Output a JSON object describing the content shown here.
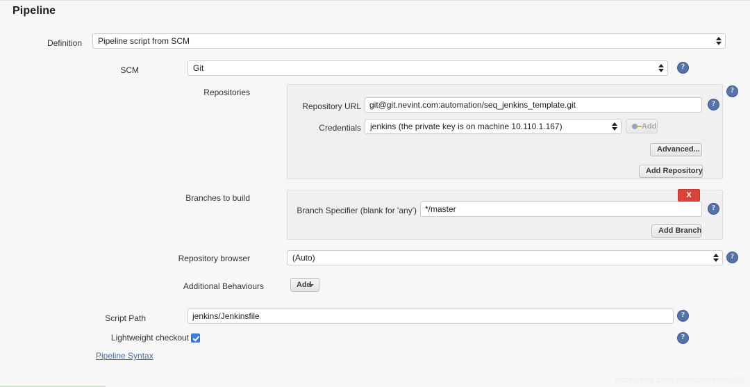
{
  "page": {
    "title": "Pipeline",
    "watermark": "https://blog.csdn.net/liuchunming033"
  },
  "definition": {
    "label": "Definition",
    "value": "Pipeline script from SCM"
  },
  "scm": {
    "label": "SCM",
    "value": "Git",
    "help": "?"
  },
  "repositories": {
    "label": "Repositories",
    "help": "?",
    "repository_url": {
      "label": "Repository URL",
      "value": "git@git.nevint.com:automation/seq_jenkins_template.git",
      "help": "?"
    },
    "credentials": {
      "label": "Credentials",
      "value": "jenkins (the private key is on machine 10.110.1.167)",
      "add_button": "Add"
    },
    "advanced_button": "Advanced...",
    "add_repository_button": "Add Repository"
  },
  "branches": {
    "label": "Branches to build",
    "delete_button": "X",
    "specifier": {
      "label": "Branch Specifier (blank for 'any')",
      "value": "*/master",
      "help": "?"
    },
    "add_branch_button": "Add Branch"
  },
  "repository_browser": {
    "label": "Repository browser",
    "value": "(Auto)",
    "help": "?"
  },
  "additional_behaviours": {
    "label": "Additional Behaviours",
    "add_button": "Add"
  },
  "script_path": {
    "label": "Script Path",
    "value": "jenkins/Jenkinsfile",
    "help": "?"
  },
  "lightweight_checkout": {
    "label": "Lightweight checkout",
    "checked": true,
    "help": "?"
  },
  "pipeline_syntax_link": "Pipeline Syntax"
}
